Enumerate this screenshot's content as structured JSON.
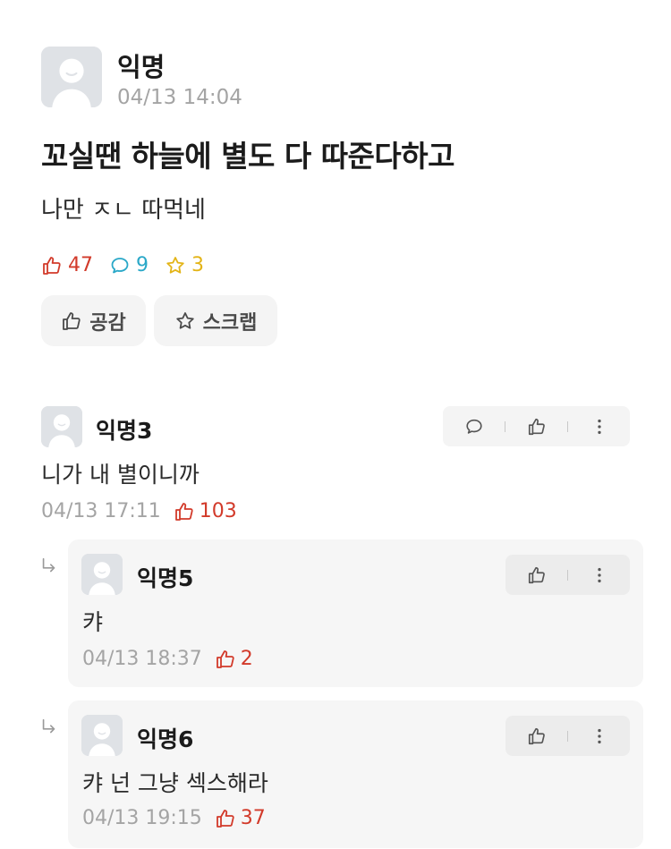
{
  "post": {
    "author": "익명",
    "date": "04/13 14:04",
    "title": "꼬실땐 하늘에 별도 다 따준다하고",
    "body": "나만 ㅈㄴ 따먹네",
    "stats": {
      "likes": "47",
      "comments": "9",
      "scraps": "3"
    },
    "buttons": {
      "like": "공감",
      "scrap": "스크랩"
    }
  },
  "comments": [
    {
      "author": "익명3",
      "text": "니가 내 별이니까",
      "date": "04/13 17:11",
      "likes": "103"
    }
  ],
  "replies": [
    {
      "author": "익명5",
      "text": "캬",
      "date": "04/13 18:37",
      "likes": "2"
    },
    {
      "author": "익명6",
      "text": "캬 넌 그냥 섹스해라",
      "date": "04/13 19:15",
      "likes": "37"
    }
  ],
  "icons": {
    "avatar": "default-avatar-icon",
    "like": "thumbs-up-icon",
    "comment": "speech-bubble-icon",
    "scrap": "star-icon",
    "more": "more-vertical-icon",
    "reply": "reply-arrow-icon"
  },
  "colors": {
    "like": "#d23a2a",
    "comment": "#2aa8c8",
    "scrap": "#e3b417",
    "meta": "#a4a4a4",
    "panel": "#f4f4f4"
  }
}
